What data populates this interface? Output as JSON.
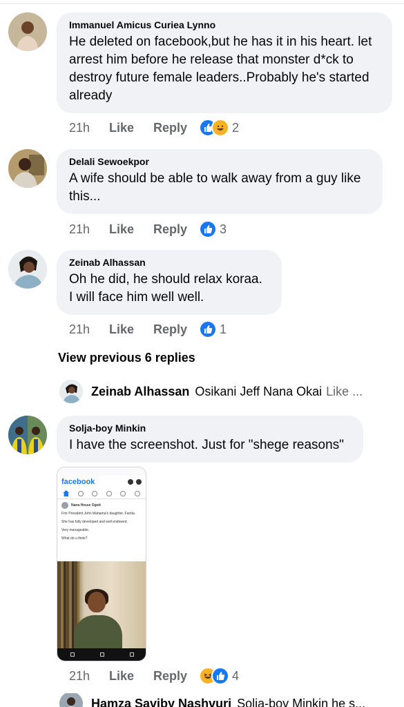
{
  "comments": [
    {
      "author": "Immanuel Amicus Curiea Lynno",
      "text": "He deleted on facebook,but he has it in his heart. let arrest him before he release that monster d*ck to destroy future female leaders..Probably he's started already",
      "time": "21h",
      "like_label": "Like",
      "reply_label": "Reply",
      "reactions": [
        "like-icon",
        "haha-icon"
      ],
      "reaction_count": "2"
    },
    {
      "author": "Delali Sewoekpor",
      "text": "A wife should be able to walk away from a guy like this...",
      "time": "21h",
      "like_label": "Like",
      "reply_label": "Reply",
      "reactions": [
        "like-icon"
      ],
      "reaction_count": "3"
    },
    {
      "author": "Zeinab Alhassan",
      "text_lines": [
        "Oh he did, he should relax koraa.",
        "I will face him well well."
      ],
      "time": "21h",
      "like_label": "Like",
      "reply_label": "Reply",
      "reactions": [
        "like-icon"
      ],
      "reaction_count": "1"
    },
    {
      "author": "Solja-boy Minkin",
      "text": "I have the screenshot. Just for \"shege reasons\"",
      "time": "21h",
      "like_label": "Like",
      "reply_label": "Reply",
      "reactions": [
        "haha-icon",
        "like-icon"
      ],
      "reaction_count": "4"
    }
  ],
  "view_previous": "View previous 6 replies",
  "reply_preview": {
    "author": "Zeinab Alhassan",
    "text": "Osikani Jeff Nana Okai",
    "more": "Like ..."
  },
  "attachment": {
    "app_name": "facebook",
    "post_author": "Nana Hesse Ogoti",
    "post_lines": [
      "Fmr President John Mahama's daughter, Farida.",
      "She has fully developed and well endowed.",
      "Very manageable.",
      "What do u think?"
    ]
  },
  "last_reply": {
    "author": "Hamza Saviby Nashvuri",
    "text": "Solja-boy Minkin he s..."
  },
  "colors": {
    "like_blue": "#1877f2",
    "haha_yellow": "#f7b125",
    "bubble": "#f0f2f5",
    "meta_grey": "#65676b"
  }
}
